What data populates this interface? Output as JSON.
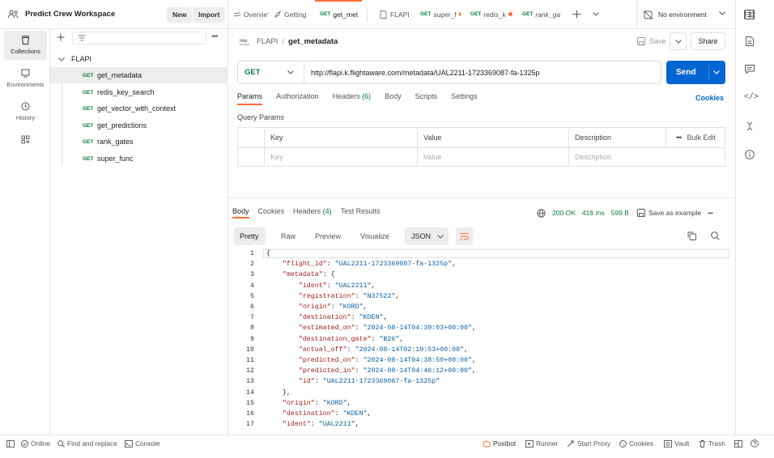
{
  "workspace": {
    "title": "Predict Crew Workspace",
    "new_label": "New",
    "import_label": "Import"
  },
  "tabs": [
    {
      "method": "",
      "label": "Overvie’",
      "dot": false
    },
    {
      "method": "",
      "label": "Getting",
      "dot": false
    },
    {
      "method": "GET",
      "label": "get_met",
      "dot": false,
      "active": true
    },
    {
      "method": "",
      "label": "FLAPI",
      "dot": false
    },
    {
      "method": "GET",
      "label": "super_f",
      "dot": true
    },
    {
      "method": "GET",
      "label": "redis_k",
      "dot": true
    },
    {
      "method": "GET",
      "label": "rank_ga",
      "dot": false
    }
  ],
  "environment": {
    "label": "No environment"
  },
  "rail": {
    "collections": "Collections",
    "environments": "Environments",
    "history": "History"
  },
  "sidebar": {
    "collection": "FLAPI",
    "requests": [
      {
        "method": "GET",
        "name": "get_metadata"
      },
      {
        "method": "GET",
        "name": "redis_key_search"
      },
      {
        "method": "GET",
        "name": "get_vector_with_context"
      },
      {
        "method": "GET",
        "name": "get_predictions"
      },
      {
        "method": "GET",
        "name": "rank_gates"
      },
      {
        "method": "GET",
        "name": "super_func"
      }
    ]
  },
  "breadcrumb": {
    "parent": "FLAPI",
    "sep": "/",
    "current": "get_metadata"
  },
  "toolbar": {
    "save": "Save",
    "share": "Share"
  },
  "request": {
    "method": "GET",
    "url": "http://flapi.k.flightaware.com/metadata/UAL2211-1723369087-fa-1325p",
    "send": "Send"
  },
  "request_tabs": [
    "Params",
    "Authorization",
    "Headers",
    "Body",
    "Scripts",
    "Settings"
  ],
  "headers_count": "(6)",
  "cookies_link": "Cookies",
  "params": {
    "title": "Query Params",
    "col_key": "Key",
    "col_value": "Value",
    "col_desc": "Description",
    "bulk_edit": "Bulk Edit",
    "ph_key": "Key",
    "ph_value": "Value",
    "ph_desc": "Description"
  },
  "response": {
    "tabs": [
      "Body",
      "Cookies",
      "Headers",
      "Test Results"
    ],
    "headers_count": "(4)",
    "status": "200 OK",
    "time": "416 ms",
    "size": "599 B",
    "save_example": "Save as example",
    "formats": [
      "Pretty",
      "Raw",
      "Preview",
      "Visualize"
    ],
    "lang": "JSON",
    "lines": [
      "{",
      "    \"flight_id\": \"UAL2211-1723369087-fa-1325p\",",
      "    \"metadata\": {",
      "        \"ident\": \"UAL2211\",",
      "        \"registration\": \"N37522\",",
      "        \"origin\": \"KORD\",",
      "        \"destination\": \"KDEN\",",
      "        \"estimated_on\": \"2024-08-14T04:39:03+00:00\",",
      "        \"destination_gate\": \"B26\",",
      "        \"actual_off\": \"2024-08-14T02:19:53+00:00\",",
      "        \"predicted_on\": \"2024-08-14T04:38:50+00:00\",",
      "        \"predicted_in\": \"2024-08-14T04:46:12+00:00\",",
      "        \"id\": \"UAL2211-1723369087-fa-1325p\"",
      "    },",
      "    \"origin\": \"KORD\",",
      "    \"destination\": \"KDEN\",",
      "    \"ident\": \"UAL2211\","
    ]
  },
  "statusbar": {
    "online": "Online",
    "find": "Find and replace",
    "console": "Console",
    "postbot": "Postbot",
    "runner": "Runner",
    "proxy": "Start Proxy",
    "cookies": "Cookies",
    "vault": "Vault",
    "trash": "Trash"
  },
  "colors": {
    "accent": "#ff6c37",
    "send": "#0265d2",
    "get": "#0c7a3f",
    "status_ok": "#0c7a3f"
  }
}
